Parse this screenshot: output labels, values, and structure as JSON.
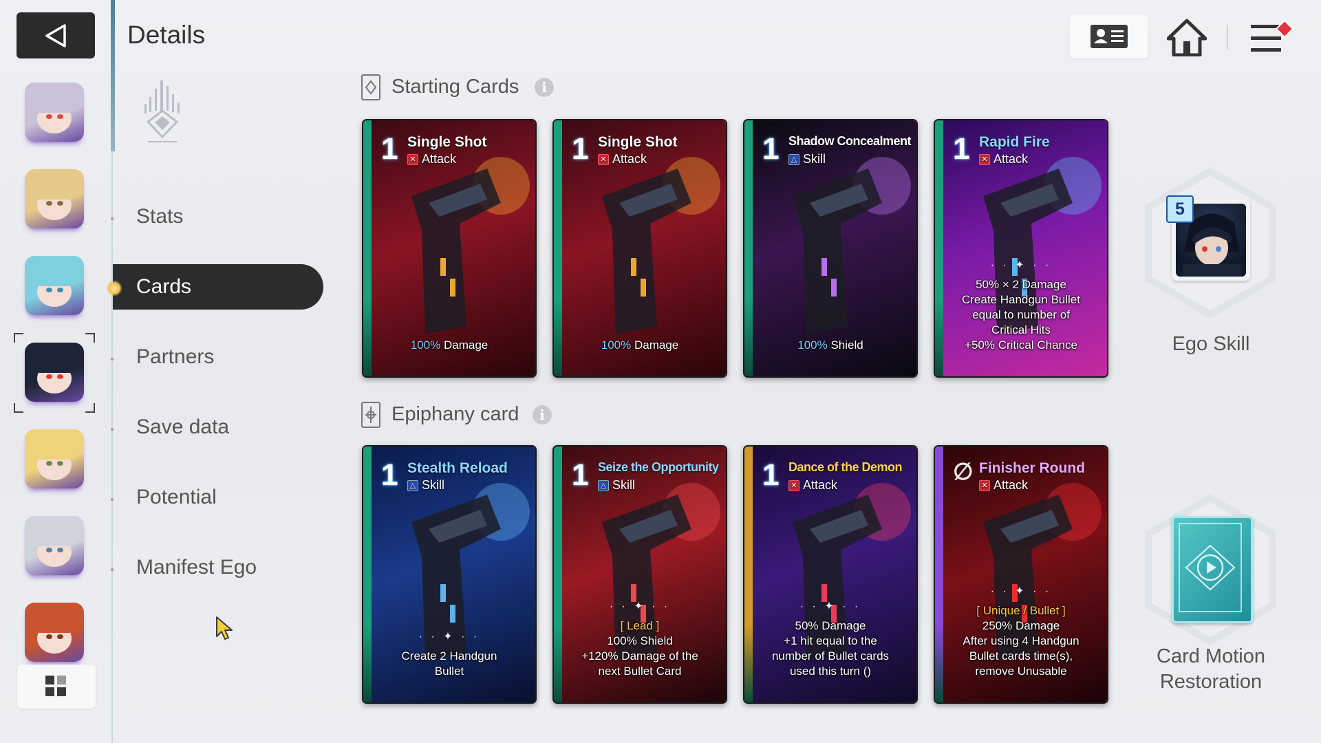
{
  "header": {
    "title": "Details",
    "back_icon": "back-triangle-icon"
  },
  "sidebar_avatars": [
    {
      "name": "avatar-1",
      "hair": "#c9c2d8",
      "eye": "#d84a4a"
    },
    {
      "name": "avatar-2",
      "hair": "#e6c989",
      "eye": "#8a6a44"
    },
    {
      "name": "avatar-3",
      "hair": "#7fd0de",
      "eye": "#3a8fae"
    },
    {
      "name": "avatar-4-selected",
      "hair": "#1d2436",
      "eye": "#e03a3a"
    },
    {
      "name": "avatar-5",
      "hair": "#efd37a",
      "eye": "#6b8a45"
    },
    {
      "name": "avatar-6",
      "hair": "#cfd3db",
      "eye": "#5f7d9b"
    },
    {
      "name": "avatar-7",
      "hair": "#c9542e",
      "eye": "#7a3a1d"
    }
  ],
  "nav": {
    "items": [
      "Stats",
      "Cards",
      "Partners",
      "Save data",
      "Potential",
      "Manifest Ego"
    ],
    "active": "Cards"
  },
  "sections": {
    "starting": "Starting Cards",
    "epiphany": "Epiphany card"
  },
  "starting_cards": [
    {
      "cost": "1",
      "name": "Single Shot",
      "type": "Attack",
      "desc_hl": "100%",
      "desc": " Damage"
    },
    {
      "cost": "1",
      "name": "Single Shot",
      "type": "Attack",
      "desc_hl": "100%",
      "desc": " Damage"
    },
    {
      "cost": "1",
      "name": "Shadow Concealment",
      "type": "Skill",
      "desc_hl": "100%",
      "desc": " Shield"
    },
    {
      "cost": "1",
      "name": "Rapid Fire",
      "type": "Attack",
      "lines": [
        "50% × 2 Damage",
        "Create Handgun Bullet",
        "equal to number of",
        "Critical Hits",
        "+50% Critical Chance"
      ]
    }
  ],
  "epiphany_cards": [
    {
      "cost": "1",
      "name": "Stealth Reload",
      "type": "Skill",
      "lines": [
        "Create 2 Handgun",
        "Bullet"
      ]
    },
    {
      "cost": "1",
      "name": "Seize the Opportunity",
      "type": "Skill",
      "tag": "[ Lead ]",
      "lines": [
        "100% Shield",
        "+120% Damage of the",
        "next Bullet Card"
      ]
    },
    {
      "cost": "1",
      "name": "Dance of the Demon",
      "type": "Attack",
      "lines": [
        "50% Damage",
        "+1 hit equal to the",
        "number of Bullet cards",
        "used this turn ()"
      ]
    },
    {
      "cost": "∅",
      "name": "Finisher Round",
      "type": "Attack",
      "tag": "[ Unique / Bullet ]",
      "lines": [
        "250% Damage",
        "After using 4 Handgun",
        "Bullet cards  time(s),",
        "remove Unusable"
      ]
    }
  ],
  "right_panel": {
    "ego_level": "5",
    "ego_label": "Ego Skill",
    "restore_label_1": "Card Motion",
    "restore_label_2": "Restoration"
  },
  "colors": {
    "accent_dark": "#2c2c2e",
    "highlight_blue": "#7ec8ff",
    "tag_gold": "#ffc84a",
    "notify_red": "#e5333b"
  }
}
